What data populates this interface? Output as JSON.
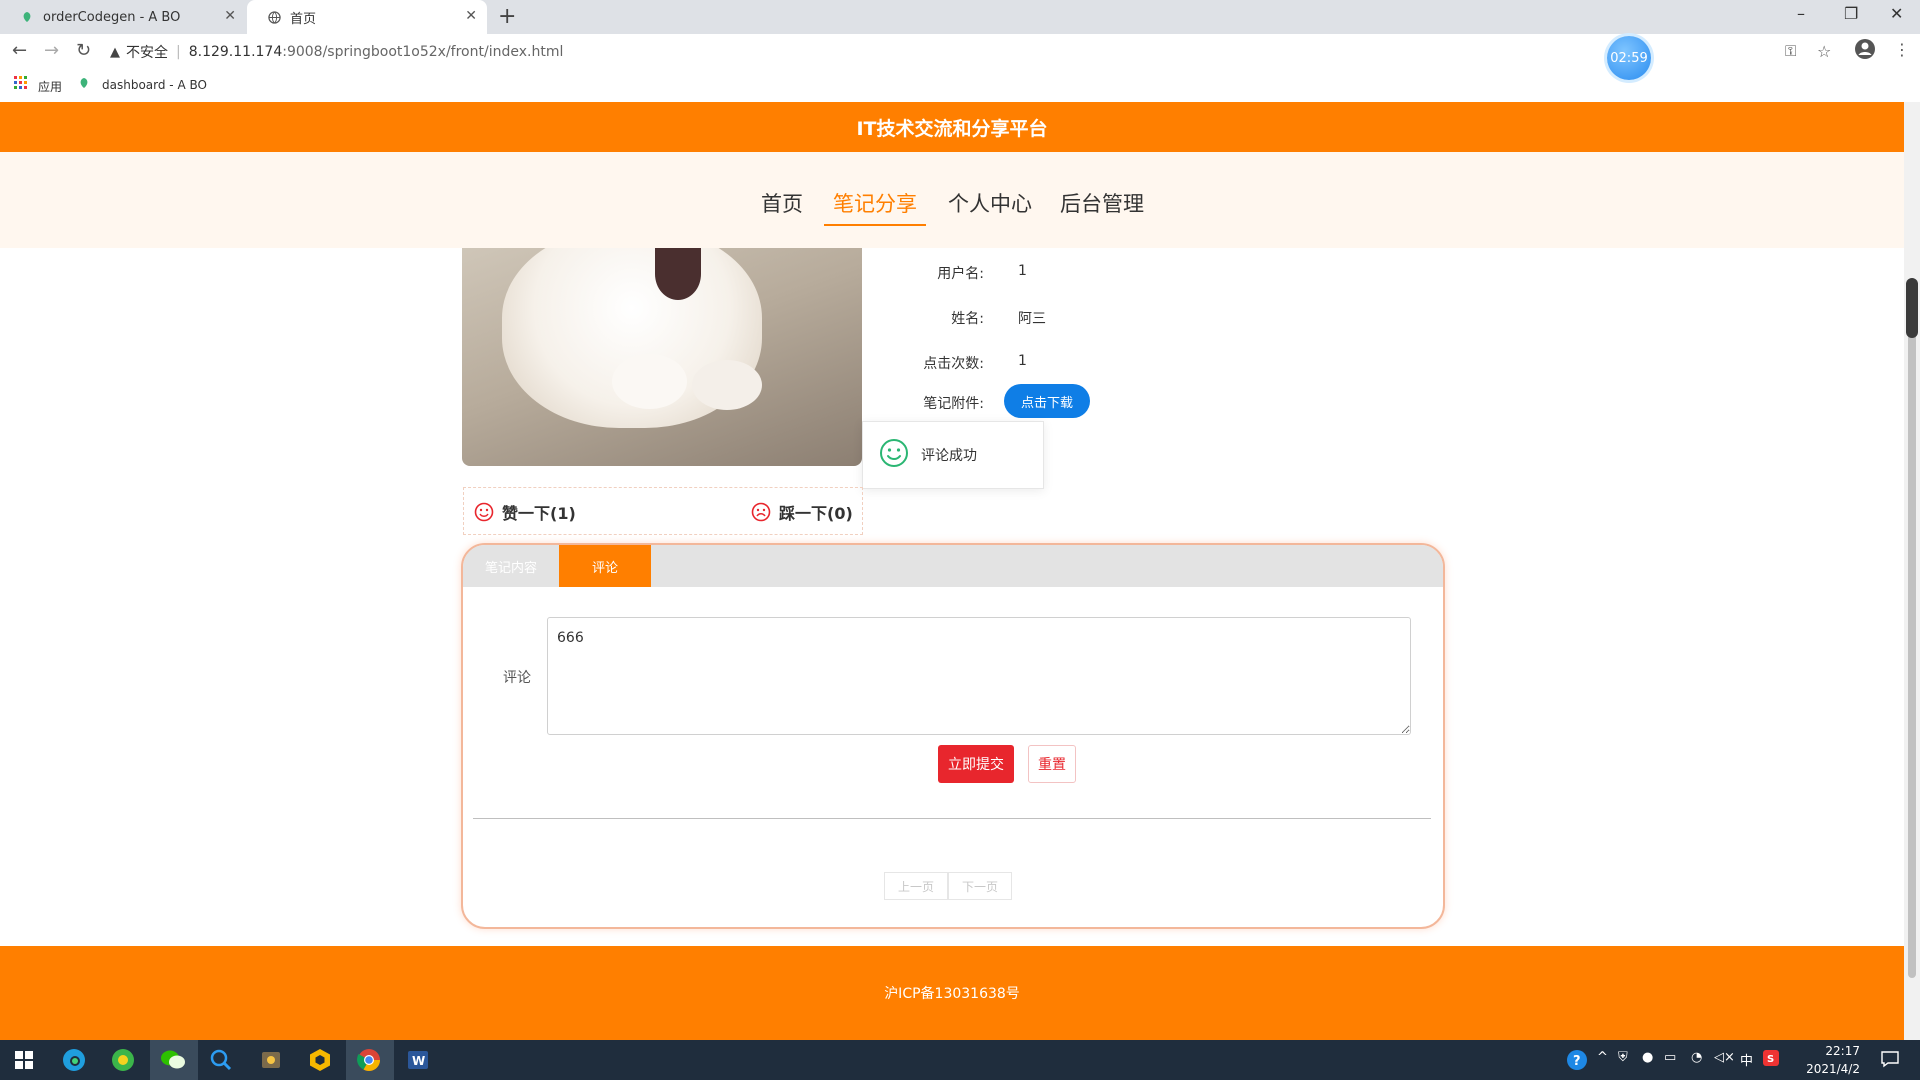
{
  "browser": {
    "tabs": [
      {
        "title": "orderCodegen - A BO",
        "active": false
      },
      {
        "title": "首页",
        "active": true
      }
    ],
    "new_tab_icon": "plus-icon",
    "window_controls": [
      "minimize-icon",
      "restore-icon",
      "close-icon"
    ],
    "address": {
      "security_label": "不安全",
      "url_host": "8.129.11.174",
      "url_rest": ":9008/springboot1o52x/front/index.html"
    },
    "timer_badge": "02:59",
    "bookmarks": [
      {
        "label": "应用",
        "icon": "apps-grid-icon"
      },
      {
        "label": "dashboard - A BO",
        "icon": "leaf-icon"
      }
    ]
  },
  "site": {
    "title": "IT技术交流和分享平台",
    "nav": [
      {
        "label": "首页",
        "active": false
      },
      {
        "label": "笔记分享",
        "active": true
      },
      {
        "label": "个人中心",
        "active": false
      },
      {
        "label": "后台管理",
        "active": false
      }
    ]
  },
  "detail": {
    "fields": [
      {
        "label": "用户名:",
        "value": "1"
      },
      {
        "label": "姓名:",
        "value": "阿三"
      },
      {
        "label": "点击次数:",
        "value": "1"
      }
    ],
    "attachment_label": "笔记附件:",
    "download_label": "点击下载",
    "like_label": "赞一下(1)",
    "dislike_label": "踩一下(0)"
  },
  "toast": {
    "message": "评论成功"
  },
  "panel": {
    "tabs": [
      {
        "label": "笔记内容",
        "active": false
      },
      {
        "label": "评论",
        "active": true
      }
    ],
    "comment_label": "评论",
    "comment_value": "666",
    "submit_label": "立即提交",
    "reset_label": "重置",
    "prev_label": "上一页",
    "next_label": "下一页"
  },
  "footer": {
    "icp": "沪ICP备13031638号"
  },
  "taskbar": {
    "time": "22:17",
    "date": "2021/4/2",
    "ime": "中"
  },
  "colors": {
    "brand_orange": "#ff7f00",
    "link_blue": "#0f7ee6",
    "danger_red": "#e8262d",
    "success_green": "#2bb673"
  }
}
